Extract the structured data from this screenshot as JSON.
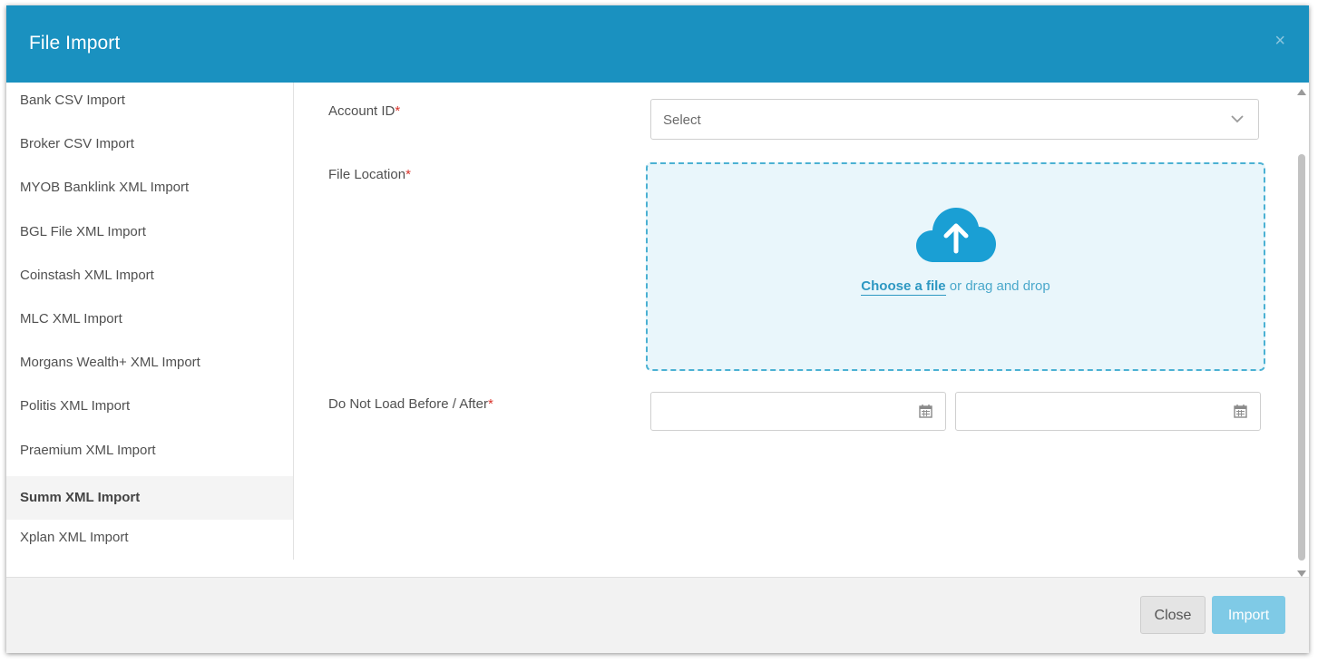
{
  "modal": {
    "title": "File Import",
    "close_icon": "×"
  },
  "sidebar": {
    "items": [
      {
        "label": "Bank CSV Import"
      },
      {
        "label": "Broker CSV Import"
      },
      {
        "label": "MYOB Banklink XML Import"
      },
      {
        "label": "BGL File XML Import"
      },
      {
        "label": "Coinstash XML Import"
      },
      {
        "label": "MLC XML Import"
      },
      {
        "label": "Morgans Wealth+ XML Import"
      },
      {
        "label": "Politis XML Import"
      },
      {
        "label": "Praemium XML Import"
      },
      {
        "label": "Summ XML Import",
        "active": true
      },
      {
        "label": "Xplan XML Import"
      }
    ]
  },
  "form": {
    "account_id": {
      "label": "Account ID",
      "required_mark": "*",
      "placeholder": "Select"
    },
    "file_location": {
      "label": "File Location",
      "required_mark": "*",
      "choose_text": "Choose a file",
      "drag_text": " or drag and drop"
    },
    "date_range": {
      "label": "Do Not Load Before / After",
      "required_mark": "*",
      "before_value": "",
      "after_value": ""
    }
  },
  "footer": {
    "close_label": "Close",
    "import_label": "Import"
  },
  "colors": {
    "header": "#1a91c0",
    "accent": "#2e98c2",
    "dropzone_bg": "#e9f6fb",
    "import_button": "#7fcae6",
    "required": "#d9342b"
  }
}
